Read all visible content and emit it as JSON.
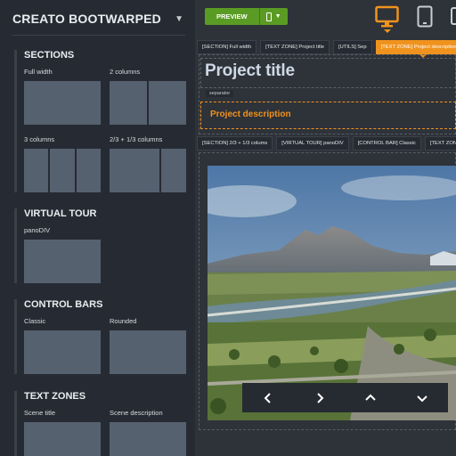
{
  "app": {
    "title": "CREATO BOOTWARPED"
  },
  "sidebar": {
    "sections": [
      {
        "title": "SECTIONS",
        "items": [
          {
            "label": "Full width"
          },
          {
            "label": "2 columns"
          },
          {
            "label": "3 columns"
          },
          {
            "label": "2/3 + 1/3 columns"
          }
        ]
      },
      {
        "title": "VIRTUAL TOUR",
        "items": [
          {
            "label": "panoDIV"
          }
        ]
      },
      {
        "title": "CONTROL BARS",
        "items": [
          {
            "label": "Classic"
          },
          {
            "label": "Rounded"
          }
        ]
      },
      {
        "title": "TEXT ZONES",
        "items": [
          {
            "label": "Scene title"
          },
          {
            "label": "Scene description"
          }
        ]
      }
    ]
  },
  "topbar": {
    "preview_label": "PREVIEW",
    "device_active": "desktop",
    "accent_color": "#f0931e",
    "button_color": "#5a9b24"
  },
  "canvas": {
    "tabs_row1": [
      "[SECTION] Full width",
      "[TEXT ZONE] Project title",
      "[UTILS] Sep",
      "[TEXT ZONE] Project description"
    ],
    "tabs_row2": [
      "[SECTION] 2/3 + 1/3 colums",
      "[VIRTUAL TOUR] panoDIV",
      "[CONTROL BAR] Classic",
      "[TEXT ZONE]"
    ],
    "project_title": "Project title",
    "separator_label": "separator",
    "project_description": "Project description"
  },
  "control_bar": {
    "buttons": [
      "chevron-left-icon",
      "chevron-right-icon",
      "chevron-up-icon",
      "chevron-down-icon"
    ]
  }
}
